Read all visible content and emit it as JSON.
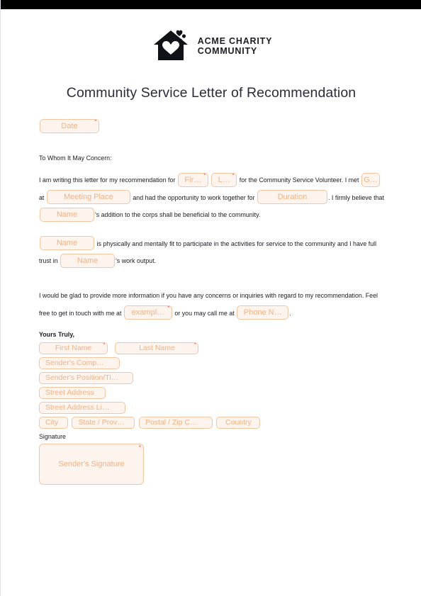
{
  "header": {
    "logo_icon": "house-heart-icon",
    "brand_line1": "ACME CHARITY",
    "brand_line2": "COMMUNITY"
  },
  "document": {
    "title": "Community Service Letter of Recommendation",
    "date_placeholder": "Date",
    "salutation": "To Whom It May Concern:",
    "paragraph1": {
      "text_a": "I am writing this letter for my recommendation for",
      "field_first_name": "Fir…",
      "field_last_name": "L…",
      "text_b": "for the Community Service Volunteer. I met",
      "field_gender": "G…",
      "text_c": "at",
      "field_meeting_place": "Meeting Place",
      "text_d": "and had the opportunity to work together for",
      "field_duration": "Duration",
      "text_e": ". I",
      "text_f": "firmly believe that",
      "field_name_1": "Name",
      "text_g": "'s addition to the corps shall be beneficial to the community."
    },
    "paragraph2": {
      "field_name_2": "Name",
      "text_a": "is physically and mentally fit to participate in the activities for service to the community and I",
      "text_b": "have full trust in",
      "field_name_3": "Name",
      "text_c": "'s work output."
    },
    "paragraph3": {
      "text_a": "I would be glad to provide more information if you have any concerns or inquiries with regard to my",
      "text_b": "recommendation. Feel free to get in touch with me at",
      "field_email": "exampl…",
      "text_c": "or you may call me at",
      "field_phone": "Phone N…",
      "text_d": "."
    },
    "closing": "Yours Truly,",
    "signature_block": {
      "field_first_name": "First Name",
      "field_last_name": "Last Name",
      "field_company": "Sender's Comp…",
      "field_position": "Sender's Position/Ti…",
      "field_street_address": "Street Address",
      "field_street_address_line2": "Street Address Li…",
      "field_city": "City",
      "field_state": "State / Prov…",
      "field_postal": "Postal / Zip C…",
      "field_country": "Country"
    },
    "signature_label": "Signature",
    "signature_placeholder": "Sender's Signature"
  },
  "colors": {
    "field_border": "#f3c6a2",
    "field_fill": "#fdf4ed",
    "field_text": "#f4b183",
    "required_marker": "#ff4d3d",
    "title_text": "#2b2b3c",
    "body_text": "#1c1c22",
    "top_bar": "#000000"
  }
}
